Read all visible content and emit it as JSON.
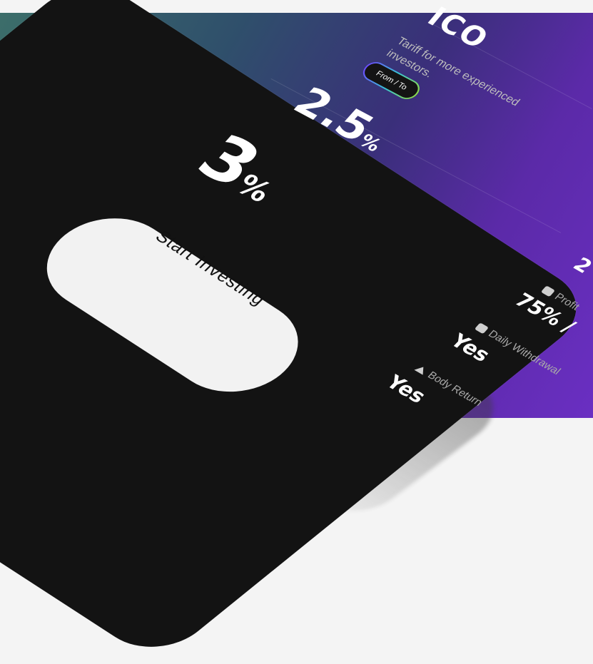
{
  "plan": {
    "title": "ICO",
    "description_lines": [
      "Tariff for more experienced",
      "investors."
    ],
    "range_badge": "From / To",
    "rate_from": "2.5",
    "rate_to": "3",
    "percent_sign": "%",
    "cta_label": "Start Investing"
  },
  "stats": {
    "top_partial": "2",
    "profit_label": "Profit",
    "profit_value": "75% /",
    "daily_withdrawal_label": "Daily Withdrawal",
    "daily_withdrawal_value": "Yes",
    "body_return_label": "Body Return",
    "body_return_value": "Yes"
  },
  "colors": {
    "card": "#131313",
    "button": "#f2f2f2",
    "badge_gradient": [
      "#6c4cff",
      "#38c2d6",
      "#8cdc4a"
    ],
    "background_gradient": [
      "#3c6e6a",
      "#3a2f7a",
      "#6a2fc2"
    ]
  },
  "icons": {
    "profit": "wallet-icon",
    "daily_withdrawal": "wallet-icon",
    "body_return": "arrow-up-icon"
  }
}
